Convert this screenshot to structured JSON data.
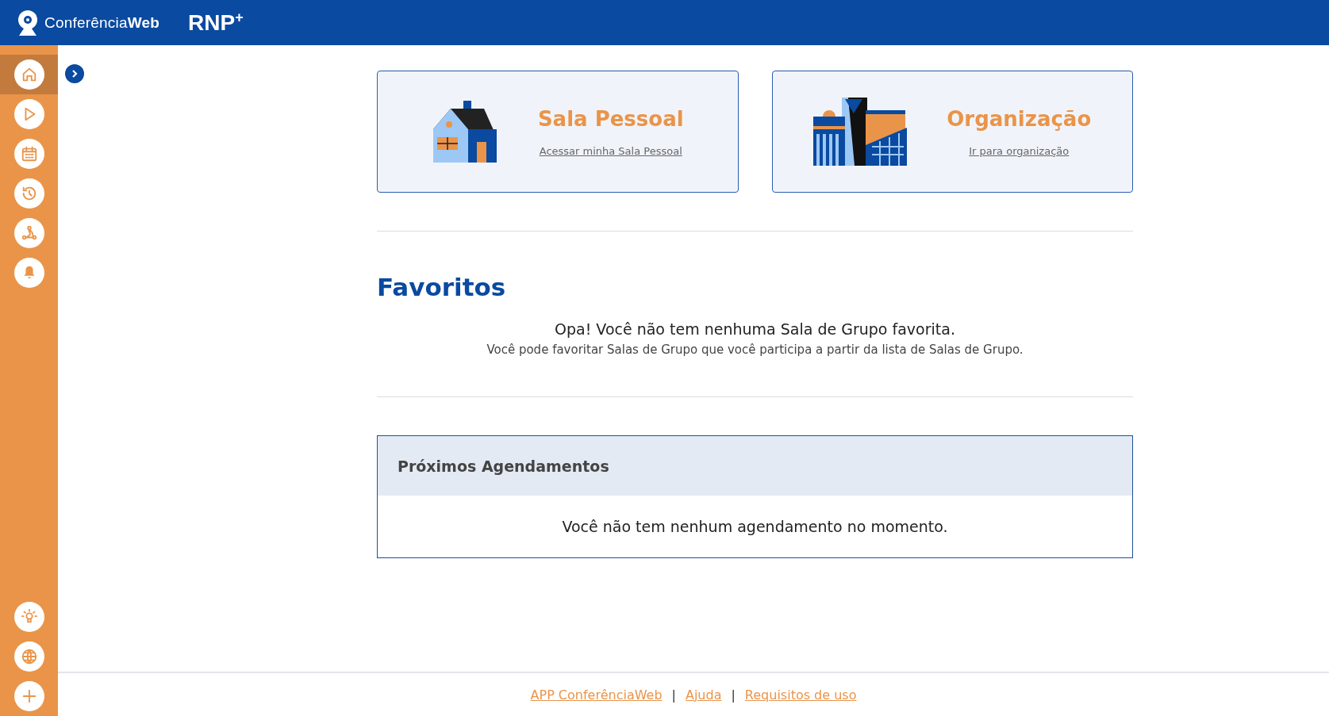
{
  "header": {
    "logo": "Conferência**Web**",
    "partner_logo": "RNP$^{+}$"
  },
  "sidebar": {
    "top_items": [
      {
        "kind": "home",
        "selected": true
      },
      {
        "kind": "play",
        "selected": false
      },
      {
        "kind": "calendar",
        "selected": false
      },
      {
        "kind": "history",
        "selected": false
      },
      {
        "kind": "network",
        "selected": false
      },
      {
        "kind": "bell",
        "selected": false
      }
    ],
    "bottom_items": [
      {
        "kind": "bulb",
        "selected": false
      },
      {
        "kind": "globe",
        "selected": false
      },
      {
        "kind": "plus",
        "selected": false
      }
    ]
  },
  "cards": [
    {
      "kind": "house",
      "title": "Sala Pessoal",
      "link": "Acessar minha Sala Pessoal"
    },
    {
      "kind": "buildings",
      "title": "Organização",
      "link": "Ir para organização"
    }
  ],
  "favorites": {
    "title": "Favoritos",
    "message": "Opa! Você não tem nenhuma Sala de Grupo favorita.",
    "hint": "Você pode favoritar Salas de Grupo que você participa a partir da lista de Salas de Grupo."
  },
  "schedule": {
    "title": "Próximos Agendamentos",
    "empty": "Você não tem nenhum agendamento no momento."
  },
  "footer": {
    "links": [
      "APP ConferênciaWeb",
      "Ajuda",
      "Requisitos de uso"
    ],
    "separator": "|"
  }
}
